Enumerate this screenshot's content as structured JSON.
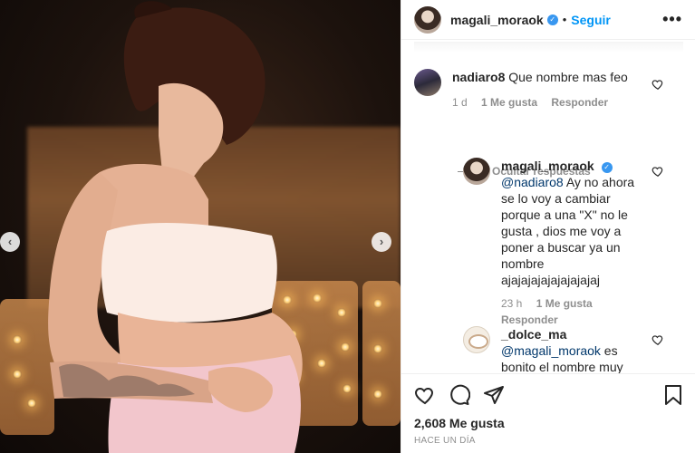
{
  "post": {
    "author": "magali_moraok",
    "separator": "•",
    "follow_label": "Seguir",
    "more_label": "•••"
  },
  "comments": [
    {
      "username": "nadiaro8",
      "text": "Que nombre mas feo",
      "time": "1 d",
      "likes": "1 Me gusta",
      "reply_label": "Responder"
    }
  ],
  "hide_replies_label": "Ocultar respuestas",
  "replies": [
    {
      "username": "magali_moraok",
      "mention": "@nadiaro8",
      "text": " Ay no ahora se lo voy a cambiar porque a una \"X\" no le gusta , dios me voy a poner a buscar ya un nombre ajajajajajajajajajaj",
      "time": "23 h",
      "likes": "1 Me gusta",
      "reply_label": "Responder"
    },
    {
      "username": "_dolce_ma",
      "mention": "@magali_moraok",
      "text": " es bonito el nombre muy"
    }
  ],
  "footer": {
    "likes_count": "2,608 Me gusta",
    "posted": "HACE UN DÍA"
  },
  "icons": {
    "prev": "chevron-left-icon",
    "next": "chevron-right-icon",
    "like": "heart-icon",
    "comment": "comment-icon",
    "share": "paper-plane-icon",
    "save": "bookmark-icon",
    "verified": "verified-badge-icon"
  },
  "colors": {
    "link_blue": "#0095f6",
    "verified_blue": "#3897f0",
    "muted": "#8e8e8e",
    "text": "#262626"
  }
}
